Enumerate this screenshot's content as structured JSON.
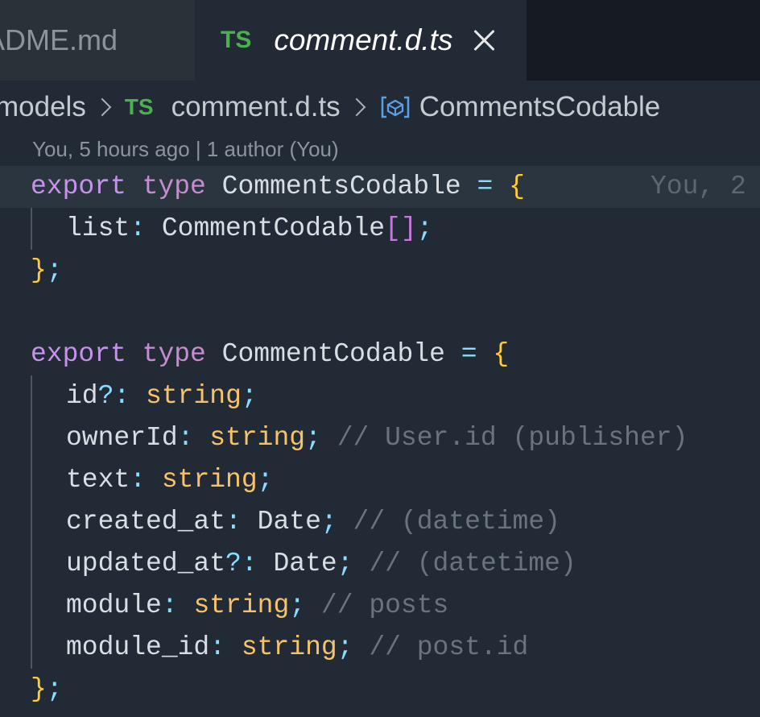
{
  "tabs": [
    {
      "label": "ADME.md",
      "active": false
    },
    {
      "label": "comment.d.ts",
      "active": true,
      "badge": "TS"
    }
  ],
  "breadcrumb": {
    "folder": "models",
    "file_badge": "TS",
    "file": "comment.d.ts",
    "symbol": "CommentsCodable"
  },
  "codelens": "You, 5 hours ago | 1 author (You)",
  "blame": "You, 2",
  "code": {
    "l1": {
      "kw": "export",
      "type_kw": "type",
      "name": "CommentsCodable",
      "eq": "=",
      "brace": "{"
    },
    "l2": {
      "prop": "list",
      "colon": ":",
      "type": "CommentCodable",
      "brackets": "[]",
      "semi": ";"
    },
    "l3": {
      "brace": "}",
      "semi": ";"
    },
    "l5": {
      "kw": "export",
      "type_kw": "type",
      "name": "CommentCodable",
      "eq": "=",
      "brace": "{"
    },
    "fields": [
      {
        "name": "id",
        "opt": "?",
        "colon": ":",
        "type": "string",
        "semi": ";",
        "comment": ""
      },
      {
        "name": "ownerId",
        "opt": "",
        "colon": ":",
        "type": "string",
        "semi": ";",
        "comment": "// User.id (publisher)"
      },
      {
        "name": "text",
        "opt": "",
        "colon": ":",
        "type": "string",
        "semi": ";",
        "comment": ""
      },
      {
        "name": "created_at",
        "opt": "",
        "colon": ":",
        "type": "Date",
        "semi": ";",
        "comment": "// (datetime)"
      },
      {
        "name": "updated_at",
        "opt": "?",
        "colon": ":",
        "type": "Date",
        "semi": ";",
        "comment": "// (datetime)"
      },
      {
        "name": "module",
        "opt": "",
        "colon": ":",
        "type": "string",
        "semi": ";",
        "comment": "// posts"
      },
      {
        "name": "module_id",
        "opt": "",
        "colon": ":",
        "type": "string",
        "semi": ";",
        "comment": "// post.id"
      }
    ],
    "l13": {
      "brace": "}",
      "semi": ";"
    }
  }
}
